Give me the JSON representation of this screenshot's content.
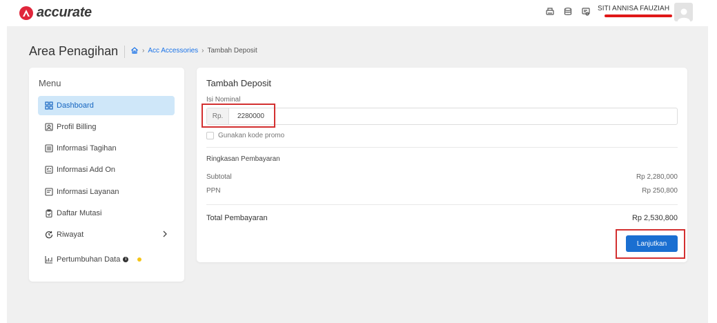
{
  "header": {
    "brand": "accurate",
    "user_name": "SITI ANNISA FAUZIAH",
    "icons": [
      "printer-icon",
      "database-icon",
      "certificate-icon",
      "user-avatar-icon"
    ],
    "brand_color": "#e0263b"
  },
  "page": {
    "title": "Area Penagihan",
    "breadcrumb": {
      "home_icon": "home-icon",
      "items": [
        "Acc Accessories",
        "Tambah Deposit"
      ]
    }
  },
  "sidebar": {
    "title": "Menu",
    "items": [
      {
        "label": "Dashboard",
        "icon": "dashboard-grid-icon",
        "active": true
      },
      {
        "label": "Profil Billing",
        "icon": "profile-card-icon"
      },
      {
        "label": "Informasi Tagihan",
        "icon": "invoice-list-icon"
      },
      {
        "label": "Informasi Add On",
        "icon": "addon-checklist-icon"
      },
      {
        "label": "Informasi Layanan",
        "icon": "service-doc-icon"
      },
      {
        "label": "Daftar Mutasi",
        "icon": "clipboard-icon"
      },
      {
        "label": "Riwayat",
        "icon": "history-icon",
        "has_chevron": true
      },
      {
        "label": "Pertumbuhan Data",
        "icon": "growth-chart-icon",
        "info": true,
        "dot_color": "#f5c518"
      }
    ],
    "active_bg": "#cfe7f9",
    "active_color": "#1565c0"
  },
  "deposit": {
    "title": "Tambah Deposit",
    "nominal_label": "Isi Nominal",
    "currency_prefix": "Rp.",
    "nominal_value": "2280000",
    "promo_label": "Gunakan kode promo",
    "summary_title": "Ringkasan Pembayaran",
    "subtotal_label": "Subtotal",
    "subtotal_value": "Rp 2,280,000",
    "ppn_label": "PPN",
    "ppn_value": "Rp 250,800",
    "total_label": "Total Pembayaran",
    "total_value": "Rp 2,530,800",
    "submit_label": "Lanjutkan",
    "button_color": "#1a6fd1",
    "highlight_color": "#d32f2f"
  }
}
